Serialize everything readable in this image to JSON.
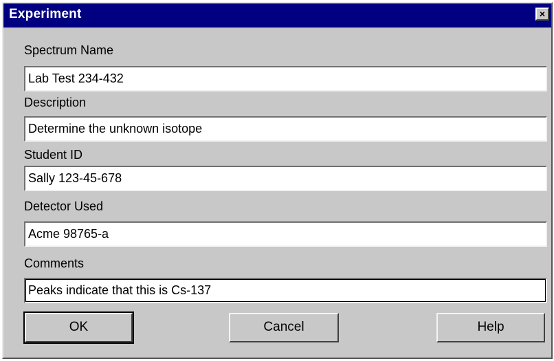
{
  "window": {
    "title": "Experiment",
    "close_glyph": "×"
  },
  "form": {
    "fields": [
      {
        "label": "Spectrum Name",
        "value": "Lab Test 234-432"
      },
      {
        "label": "Description",
        "value": "Determine the unknown isotope"
      },
      {
        "label": "Student ID",
        "value": "Sally 123-45-678"
      },
      {
        "label": "Detector Used",
        "value": "Acme 98765-a"
      },
      {
        "label": "Comments",
        "value": "Peaks indicate that this is Cs-137"
      }
    ]
  },
  "buttons": {
    "ok": "OK",
    "cancel": "Cancel",
    "help": "Help"
  },
  "colors": {
    "titlebar": "#000080",
    "face": "#c8c8c8"
  }
}
